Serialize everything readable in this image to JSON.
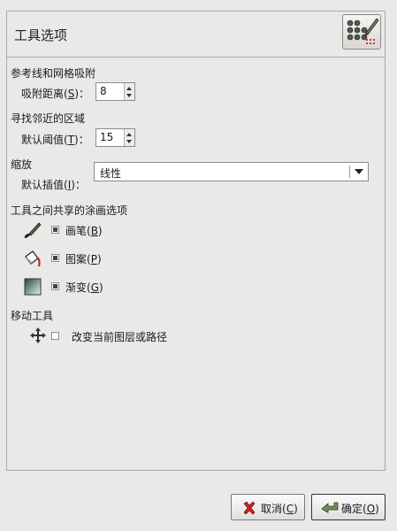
{
  "header": {
    "title": "工具选项",
    "icon": "tool-options-icon"
  },
  "sections": {
    "guides": {
      "title": "参考线和网格吸附",
      "label_pre": "吸附距离(",
      "label_key": "S",
      "label_post": ")：",
      "value": "8"
    },
    "region": {
      "title": "寻找邻近的区域",
      "label_pre": "默认阈值(",
      "label_key": "T",
      "label_post": ")：",
      "value": "15"
    },
    "scaling": {
      "title": "缩放",
      "label_pre": "默认插值(",
      "label_key": "I",
      "label_post": ")：",
      "value": "线性"
    },
    "paint": {
      "title": "工具之间共享的涂画选项",
      "items": [
        {
          "pre": "画笔(",
          "key": "B",
          "post": ")",
          "checked": true,
          "icon": "brush-icon"
        },
        {
          "pre": "图案(",
          "key": "P",
          "post": ")",
          "checked": true,
          "icon": "pattern-bucket-icon"
        },
        {
          "pre": "渐变(",
          "key": "G",
          "post": ")",
          "checked": true,
          "icon": "gradient-icon"
        }
      ]
    },
    "move": {
      "title": "移动工具",
      "label": "改变当前图层或路径",
      "checked": false,
      "icon": "move-arrows-icon"
    }
  },
  "buttons": {
    "cancel": {
      "pre": "取消(",
      "key": "C",
      "post": ")"
    },
    "ok": {
      "pre": "确定(",
      "key": "O",
      "post": ")"
    }
  }
}
